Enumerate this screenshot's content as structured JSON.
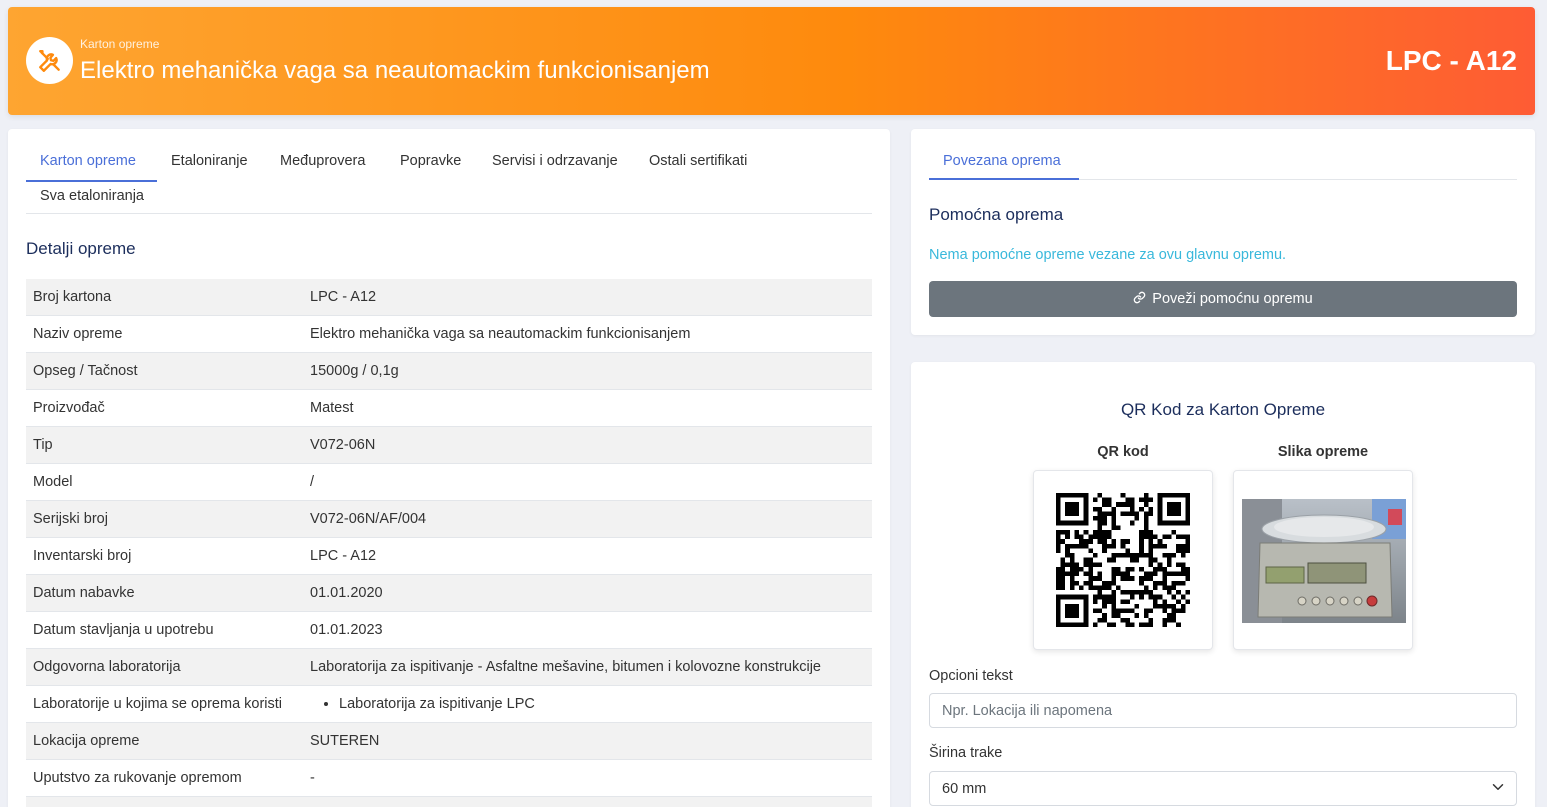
{
  "header": {
    "subtitle": "Karton opreme",
    "title": "Elektro mehanička vaga sa neautomackim funkcionisanjem",
    "code": "LPC - A12",
    "icon": "tools-icon"
  },
  "tabs": [
    {
      "label": "Karton opreme",
      "active": true
    },
    {
      "label": "Etaloniranje"
    },
    {
      "label": "Međuprovera"
    },
    {
      "label": "Popravke"
    },
    {
      "label": "Servisi i odrzavanje"
    },
    {
      "label": "Ostali sertifikati"
    },
    {
      "label": "Sva etaloniranja"
    }
  ],
  "details": {
    "title": "Detalji opreme",
    "rows": [
      {
        "label": "Broj kartona",
        "value": "LPC - A12"
      },
      {
        "label": "Naziv opreme",
        "value": "Elektro mehanička vaga sa neautomackim funkcionisanjem"
      },
      {
        "label": "Opseg / Tačnost",
        "value": "15000g / 0,1g"
      },
      {
        "label": "Proizvođač",
        "value": "Matest"
      },
      {
        "label": "Tip",
        "value": "V072-06N"
      },
      {
        "label": "Model",
        "value": "/"
      },
      {
        "label": "Serijski broj",
        "value": "V072-06N/AF/004"
      },
      {
        "label": "Inventarski broj",
        "value": "LPC - A12"
      },
      {
        "label": "Datum nabavke",
        "value": "01.01.2020"
      },
      {
        "label": "Datum stavljanja u upotrebu",
        "value": "01.01.2023"
      },
      {
        "label": "Odgovorna laboratorija",
        "value": "Laboratorija za ispitivanje - Asfaltne mešavine, bitumen i kolovozne konstrukcije"
      },
      {
        "label": "Laboratorije u kojima se oprema koristi",
        "value": "Laboratorija za ispitivanje LPC"
      },
      {
        "label": "Lokacija opreme",
        "value": "SUTEREN"
      },
      {
        "label": "Uputstvo za rukovanje opremom",
        "value": "-"
      }
    ]
  },
  "related": {
    "tab": "Povezana oprema",
    "section_title": "Pomoćna oprema",
    "empty_text": "Nema pomoćne opreme vezane za ovu glavnu opremu.",
    "button_label": "Poveži pomoćnu opremu"
  },
  "qr": {
    "title": "QR Kod za Karton Opreme",
    "qr_label": "QR kod",
    "image_label": "Slika opreme",
    "optional_text_label": "Opcioni tekst",
    "optional_text_placeholder": "Npr. Lokacija ili napomena",
    "width_label": "Širina trake",
    "width_value": "60 mm"
  },
  "colors": {
    "accent": "#4a6fd8",
    "header_start": "#fea531",
    "header_end": "#fe5c34",
    "info": "#39b8db",
    "button_gray": "#6c757d"
  }
}
